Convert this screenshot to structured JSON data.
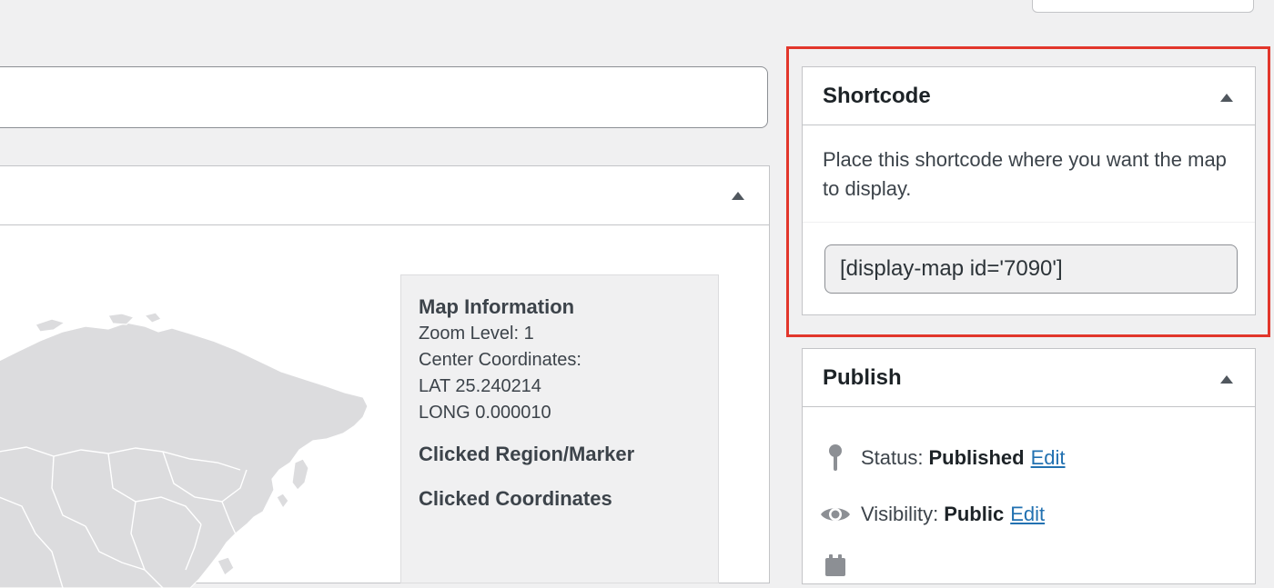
{
  "title_field": {
    "value": ""
  },
  "map_info": {
    "heading": "Map Information",
    "zoom": "Zoom Level: 1",
    "center_label": "Center Coordinates:",
    "lat": "LAT 25.240214",
    "long": "LONG 0.000010",
    "clicked_region": "Clicked Region/Marker",
    "clicked_coords": "Clicked Coordinates"
  },
  "shortcode_box": {
    "title": "Shortcode",
    "description": "Place this shortcode where you want the map to display.",
    "value": "[display-map id='7090']"
  },
  "publish_box": {
    "title": "Publish",
    "status_label": "Status:",
    "status_value": "Published",
    "status_edit": "Edit",
    "visibility_label": "Visibility:",
    "visibility_value": "Public",
    "visibility_edit": "Edit"
  },
  "colors": {
    "highlight_frame": "#e2362b",
    "link": "#2271b1",
    "background": "#f0f0f1"
  },
  "icons": {
    "status": "pin-icon",
    "visibility": "eye-icon",
    "schedule": "calendar-icon",
    "collapse": "triangle-up-icon"
  }
}
